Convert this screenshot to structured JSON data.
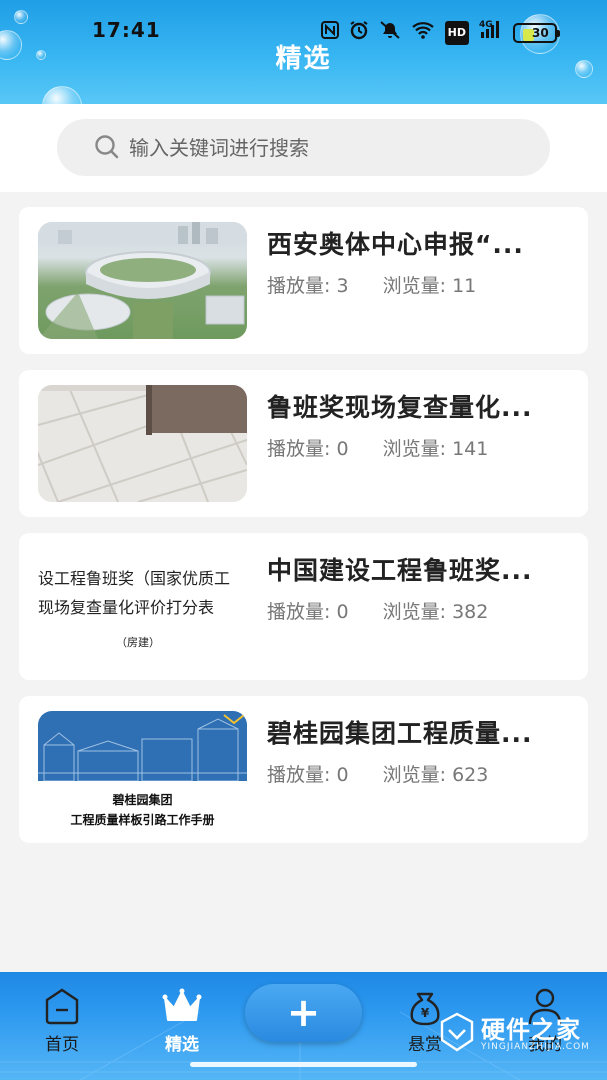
{
  "status_bar": {
    "time": "17:41",
    "icons": [
      "nfc-icon",
      "alarm-icon",
      "mute-icon",
      "wifi-icon",
      "hd-icon",
      "signal-icon"
    ],
    "hd_label": "HD",
    "network_label": "4G",
    "battery": "30",
    "battery_level": 0.3
  },
  "header": {
    "title": "精选"
  },
  "search": {
    "placeholder": "输入关键词进行搜索"
  },
  "cards": [
    {
      "title": "西安奥体中心申报“...",
      "play_label": "播放量:",
      "play_count": "3",
      "view_label": "浏览量:",
      "view_count": "11",
      "thumb": "stadium-photo"
    },
    {
      "title": "鲁班奖现场复查量化...",
      "play_label": "播放量:",
      "play_count": "0",
      "view_label": "浏览量:",
      "view_count": "141",
      "thumb": "tile-floor-photo"
    },
    {
      "title": "中国建设工程鲁班奖...",
      "play_label": "播放量:",
      "play_count": "0",
      "view_label": "浏览量:",
      "view_count": "382",
      "thumb": "document-cover",
      "thumb_text": [
        "设工程鲁班奖（国家优质工",
        "现场复查量化评价打分表",
        "（房建）"
      ]
    },
    {
      "title": "碧桂园集团工程质量...",
      "play_label": "播放量:",
      "play_count": "0",
      "view_label": "浏览量:",
      "view_count": "623",
      "thumb": "book-cover",
      "thumb_text": [
        "碧桂园集团",
        "工程质量样板引路工作手册"
      ]
    }
  ],
  "bottom_nav": {
    "items": [
      {
        "label": "首页",
        "icon": "home-icon",
        "active": false
      },
      {
        "label": "精选",
        "icon": "crown-icon",
        "active": true
      },
      {
        "label": "",
        "icon": "plus-icon",
        "active": false
      },
      {
        "label": "悬赏",
        "icon": "money-bag-icon",
        "active": false
      },
      {
        "label": "我的",
        "icon": "user-icon",
        "active": false
      }
    ]
  },
  "watermark": {
    "text": "硬件之家",
    "sub": "YINGJIANZHIJIA.COM"
  },
  "colors": {
    "header_blue": "#2aa9ee",
    "nav_blue": "#2f9af0",
    "title_text": "#222222",
    "stat_text": "#777777"
  }
}
